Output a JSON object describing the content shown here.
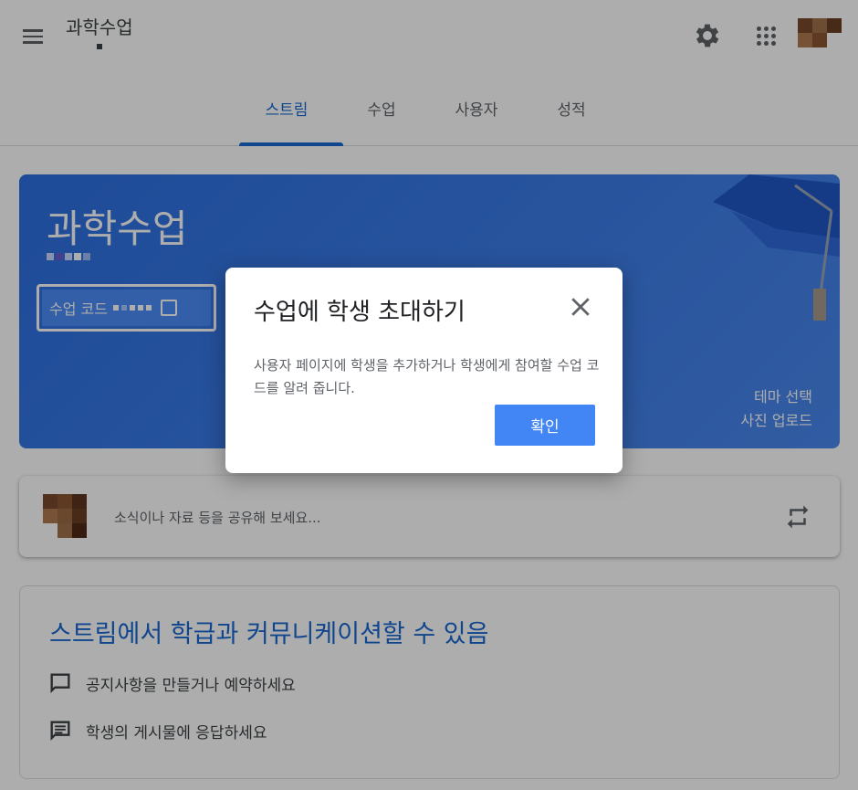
{
  "header": {
    "class_title": "과학수업",
    "tabs": [
      {
        "label": "스트림",
        "active": true
      },
      {
        "label": "수업",
        "active": false
      },
      {
        "label": "사용자",
        "active": false
      },
      {
        "label": "성적",
        "active": false
      }
    ]
  },
  "banner": {
    "title": "과학수업",
    "code_label": "수업 코드",
    "theme_link": "테마 선택",
    "upload_link": "사진 업로드"
  },
  "share": {
    "placeholder": "소식이나 자료 등을 공유해 보세요..."
  },
  "info_card": {
    "title": "스트림에서 학급과 커뮤니케이션할 수 있음",
    "items": [
      "공지사항을 만들거나 예약하세요",
      "학생의 게시물에 응답하세요"
    ]
  },
  "dialog": {
    "title": "수업에 학생 초대하기",
    "body": "사용자 페이지에 학생을 추가하거나 학생에게 참여할 수업 코드를 알려 줍니다.",
    "confirm_label": "확인"
  },
  "colors": {
    "accent": "#1967d2",
    "banner": "#3d7eea",
    "button": "#4285f4"
  }
}
